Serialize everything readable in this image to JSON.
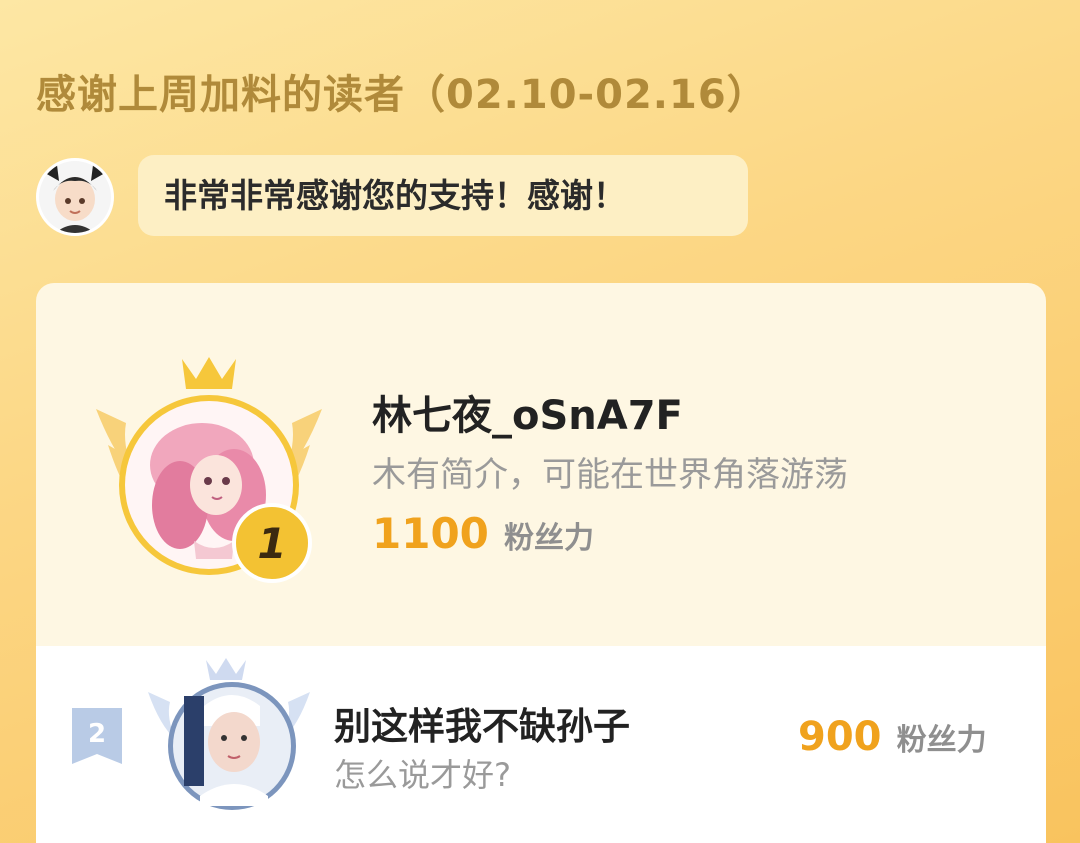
{
  "header": {
    "title": "感谢上周加料的读者（02.10-02.16）"
  },
  "author": {
    "avatar_icon": "author-avatar-icon",
    "message": "非常非常感谢您的支持！感谢！"
  },
  "leaderboard": [
    {
      "rank": "1",
      "name": "林七夜_oSnA7F",
      "bio": "木有简介，可能在世界角落游荡",
      "score": "1100",
      "unit": "粉丝力"
    },
    {
      "rank": "2",
      "name": "别这样我不缺孙子",
      "bio": "怎么说才好?",
      "score": "900",
      "unit": "粉丝力"
    }
  ],
  "colors": {
    "accent": "#f0a21d",
    "title": "#b08a3a",
    "gold": "#f6c73b",
    "silver": "#8fa6c9"
  }
}
